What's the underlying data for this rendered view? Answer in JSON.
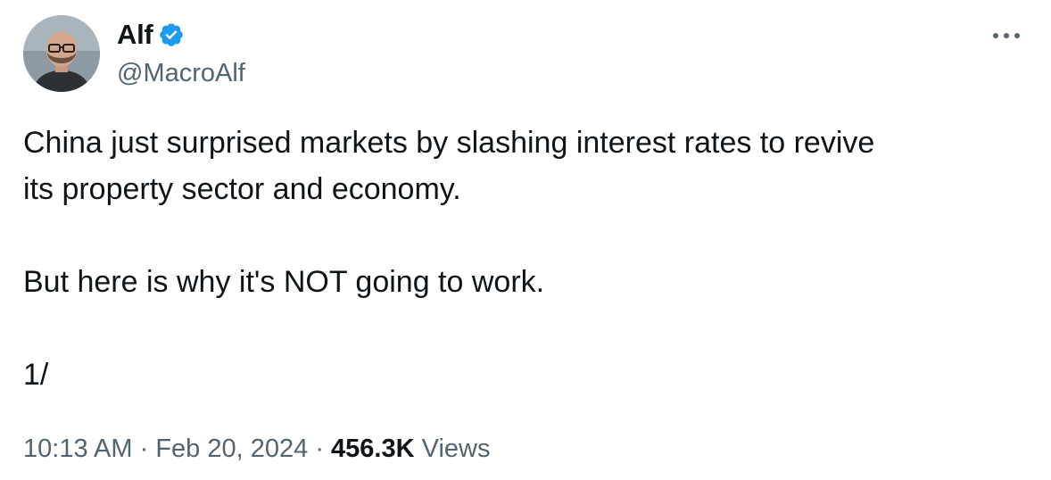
{
  "author": {
    "display_name": "Alf",
    "handle": "@MacroAlf",
    "verified": true,
    "verified_color": "#1d9bf0"
  },
  "tweet": {
    "line1": "China just surprised markets by slashing interest rates to revive",
    "line2": "its property sector and economy.",
    "paragraph2": "But here is why it's NOT going to work.",
    "paragraph3": "1/"
  },
  "meta": {
    "time": "10:13 AM",
    "separator": "·",
    "date": "Feb 20, 2024",
    "views_count": "456.3K",
    "views_label": "Views"
  },
  "icons": {
    "more": "more-icon",
    "verified": "verified-badge-icon"
  }
}
